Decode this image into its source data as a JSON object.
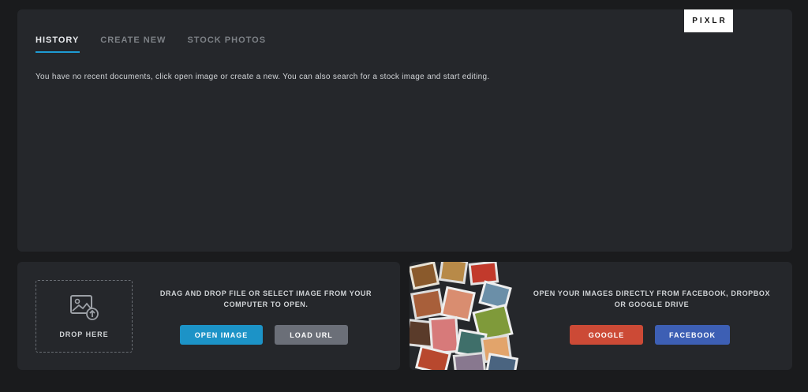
{
  "brand": {
    "logo_text": "PIXLR"
  },
  "history": {
    "tabs": [
      {
        "label": "HISTORY",
        "active": true
      },
      {
        "label": "CREATE NEW",
        "active": false
      },
      {
        "label": "STOCK PHOTOS",
        "active": false
      }
    ],
    "message": "You have no recent documents, click open image or create a new. You can also search for a stock image and start editing."
  },
  "drop": {
    "zone_label": "DROP HERE",
    "caption_line1": "DRAG AND DROP FILE OR SELECT IMAGE FROM YOUR",
    "caption_line2": "COMPUTER TO OPEN.",
    "open_image_label": "OPEN IMAGE",
    "load_url_label": "LOAD URL"
  },
  "cloud": {
    "caption_line1": "OPEN YOUR IMAGES DIRECTLY FROM FACEBOOK, DROPBOX",
    "caption_line2": "OR GOOGLE DRIVE",
    "google_label": "GOOGLE",
    "facebook_label": "FACEBOOK"
  },
  "colors": {
    "background": "#1a1b1d",
    "panel": "#25272b",
    "accent": "#1e9bd4",
    "open_image": "#1c93c7",
    "load_url": "#6b6f78",
    "google": "#cc4a36",
    "facebook": "#3d5fb4"
  },
  "icons": {
    "drop_zone": "image-upload-icon",
    "collage": "photo-collage-image"
  }
}
